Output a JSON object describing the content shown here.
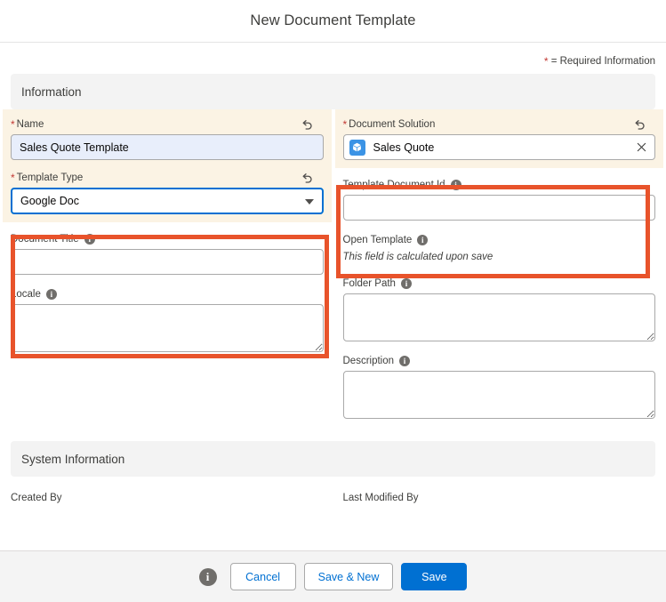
{
  "modal": {
    "title": "New Document Template",
    "required_legend_star": "*",
    "required_legend_text": "= Required Information"
  },
  "sections": {
    "information": {
      "title": "Information"
    },
    "system_information": {
      "title": "System Information"
    }
  },
  "fields": {
    "name": {
      "label": "Name",
      "required_marker": "*",
      "value": "Sales Quote Template",
      "placeholder": "",
      "revert_icon": "undo-icon"
    },
    "template_type": {
      "label": "Template Type",
      "required_marker": "*",
      "value": "Google Doc",
      "revert_icon": "undo-icon",
      "caret_icon": "chevron-down-icon",
      "options": [
        "Google Doc"
      ]
    },
    "document_title": {
      "label": "Document Title",
      "value": "",
      "placeholder": "",
      "info_icon": "info-icon"
    },
    "locale": {
      "label": "Locale",
      "value": "",
      "placeholder": "",
      "info_icon": "info-icon"
    },
    "document_solution": {
      "label": "Document Solution",
      "required_marker": "*",
      "value": "Sales Quote",
      "record_icon": "cube-icon",
      "clear_icon": "close-icon",
      "revert_icon": "undo-icon"
    },
    "template_document_id": {
      "label": "Template Document Id",
      "value": "",
      "placeholder": "",
      "info_icon": "info-icon"
    },
    "open_template": {
      "label": "Open Template",
      "info_icon": "info-icon",
      "note": "This field is calculated upon save"
    },
    "folder_path": {
      "label": "Folder Path",
      "value": "",
      "placeholder": "",
      "info_icon": "info-icon"
    },
    "description": {
      "label": "Description",
      "value": "",
      "placeholder": "",
      "info_icon": "info-icon"
    },
    "created_by": {
      "label": "Created By",
      "value": ""
    },
    "last_modified_by": {
      "label": "Last Modified By",
      "value": ""
    }
  },
  "footer": {
    "info_icon": "info-icon",
    "info_glyph": "i",
    "cancel_label": "Cancel",
    "save_new_label": "Save & New",
    "save_label": "Save"
  },
  "icons": {
    "info_glyph": "i"
  },
  "colors": {
    "brand_blue": "#0070d2",
    "required_star_red": "#c23934",
    "required_field_bg": "#fbf3e4",
    "modified_input_bg": "#e8eefb",
    "section_header_bg": "#f3f3f3",
    "annotation_orange": "#e8532b",
    "footer_bg": "#f4f4f4",
    "lookup_icon_blue": "#3b93e5"
  }
}
